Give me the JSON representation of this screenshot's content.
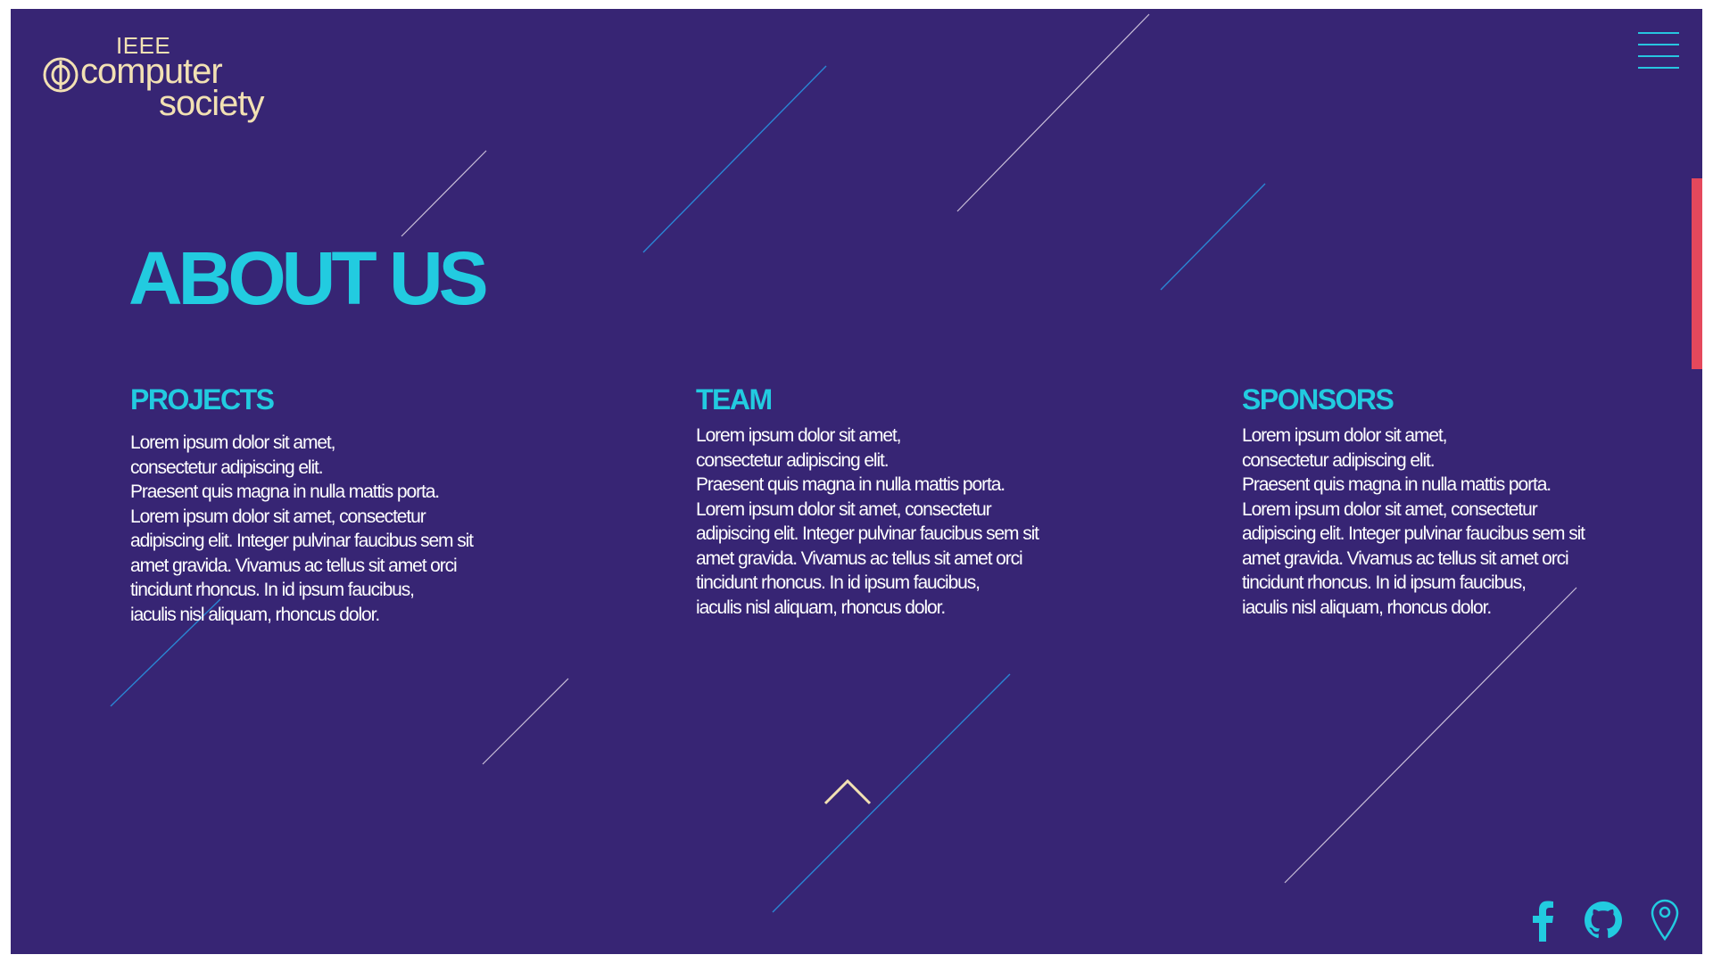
{
  "logo": {
    "line1": "IEEE",
    "line2": "computer",
    "line3": "society",
    "color": "#f2e1b3"
  },
  "menu": {
    "icon": "hamburger-menu-icon"
  },
  "page": {
    "title": "ABOUT US"
  },
  "colors": {
    "background": "#372574",
    "accent_cyan": "#22cbe0",
    "accent_blue": "#2a86d4",
    "side_accent": "#e5485c",
    "text": "#ffffff"
  },
  "sections": [
    {
      "id": "projects",
      "heading": "PROJECTS",
      "lines": [
        "Lorem ipsum dolor sit amet,",
        "consectetur adipiscing elit.",
        "Praesent quis magna in nulla mattis porta.",
        "Lorem ipsum dolor sit amet, consectetur",
        "adipiscing elit. Integer pulvinar faucibus sem sit",
        "amet gravida. Vivamus ac tellus sit amet orci",
        "tincidunt rhoncus. In id ipsum faucibus,",
        "iaculis nisl aliquam, rhoncus dolor."
      ]
    },
    {
      "id": "team",
      "heading": "TEAM",
      "lines": [
        "Lorem ipsum dolor sit amet,",
        "consectetur adipiscing elit.",
        "Praesent quis magna in nulla mattis porta.",
        "Lorem ipsum dolor sit amet, consectetur",
        "adipiscing elit. Integer pulvinar faucibus sem sit",
        "amet gravida. Vivamus ac tellus sit amet orci",
        "tincidunt rhoncus. In id ipsum faucibus,",
        "iaculis nisl aliquam, rhoncus dolor."
      ]
    },
    {
      "id": "sponsors",
      "heading": "SPONSORS",
      "lines": [
        "Lorem ipsum dolor sit amet,",
        "consectetur adipiscing elit.",
        "Praesent quis magna in nulla mattis porta.",
        "Lorem ipsum dolor sit amet, consectetur",
        "adipiscing elit. Integer pulvinar faucibus sem sit",
        "amet gravida. Vivamus ac tellus sit amet orci",
        "tincidunt rhoncus. In id ipsum faucibus,",
        "iaculis nisl aliquam, rhoncus dolor."
      ]
    }
  ],
  "scroll_up": {
    "icon": "chevron-up-icon"
  },
  "social": [
    {
      "icon": "facebook-icon"
    },
    {
      "icon": "github-icon"
    },
    {
      "icon": "location-pin-icon"
    }
  ]
}
